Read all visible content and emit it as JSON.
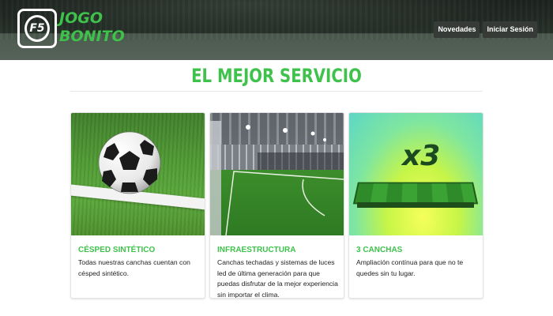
{
  "brand": {
    "logo_mark": "F5",
    "line1": "JOGO",
    "line2": "BONITO",
    "accent_color": "#3ec24b"
  },
  "nav": {
    "items": [
      {
        "label": "Novedades"
      },
      {
        "label": "Iniciar Sesión"
      }
    ]
  },
  "section": {
    "title": "EL MEJOR SERVICIO"
  },
  "cards": [
    {
      "title": "CÉSPED SINTÉTICO",
      "text": "Todas nuestras canchas cuentan con césped sintético."
    },
    {
      "title": "INFRAESTRUCTURA",
      "text": "Canchas techadas y sistemas de luces led de última generación para que puedas disfrutar de la mejor experiencia sin importar el clima."
    },
    {
      "title": "3 CANCHAS",
      "text": "Ampliación contínua para que no te quedes sin tu lugar.",
      "badge": "x3"
    }
  ]
}
